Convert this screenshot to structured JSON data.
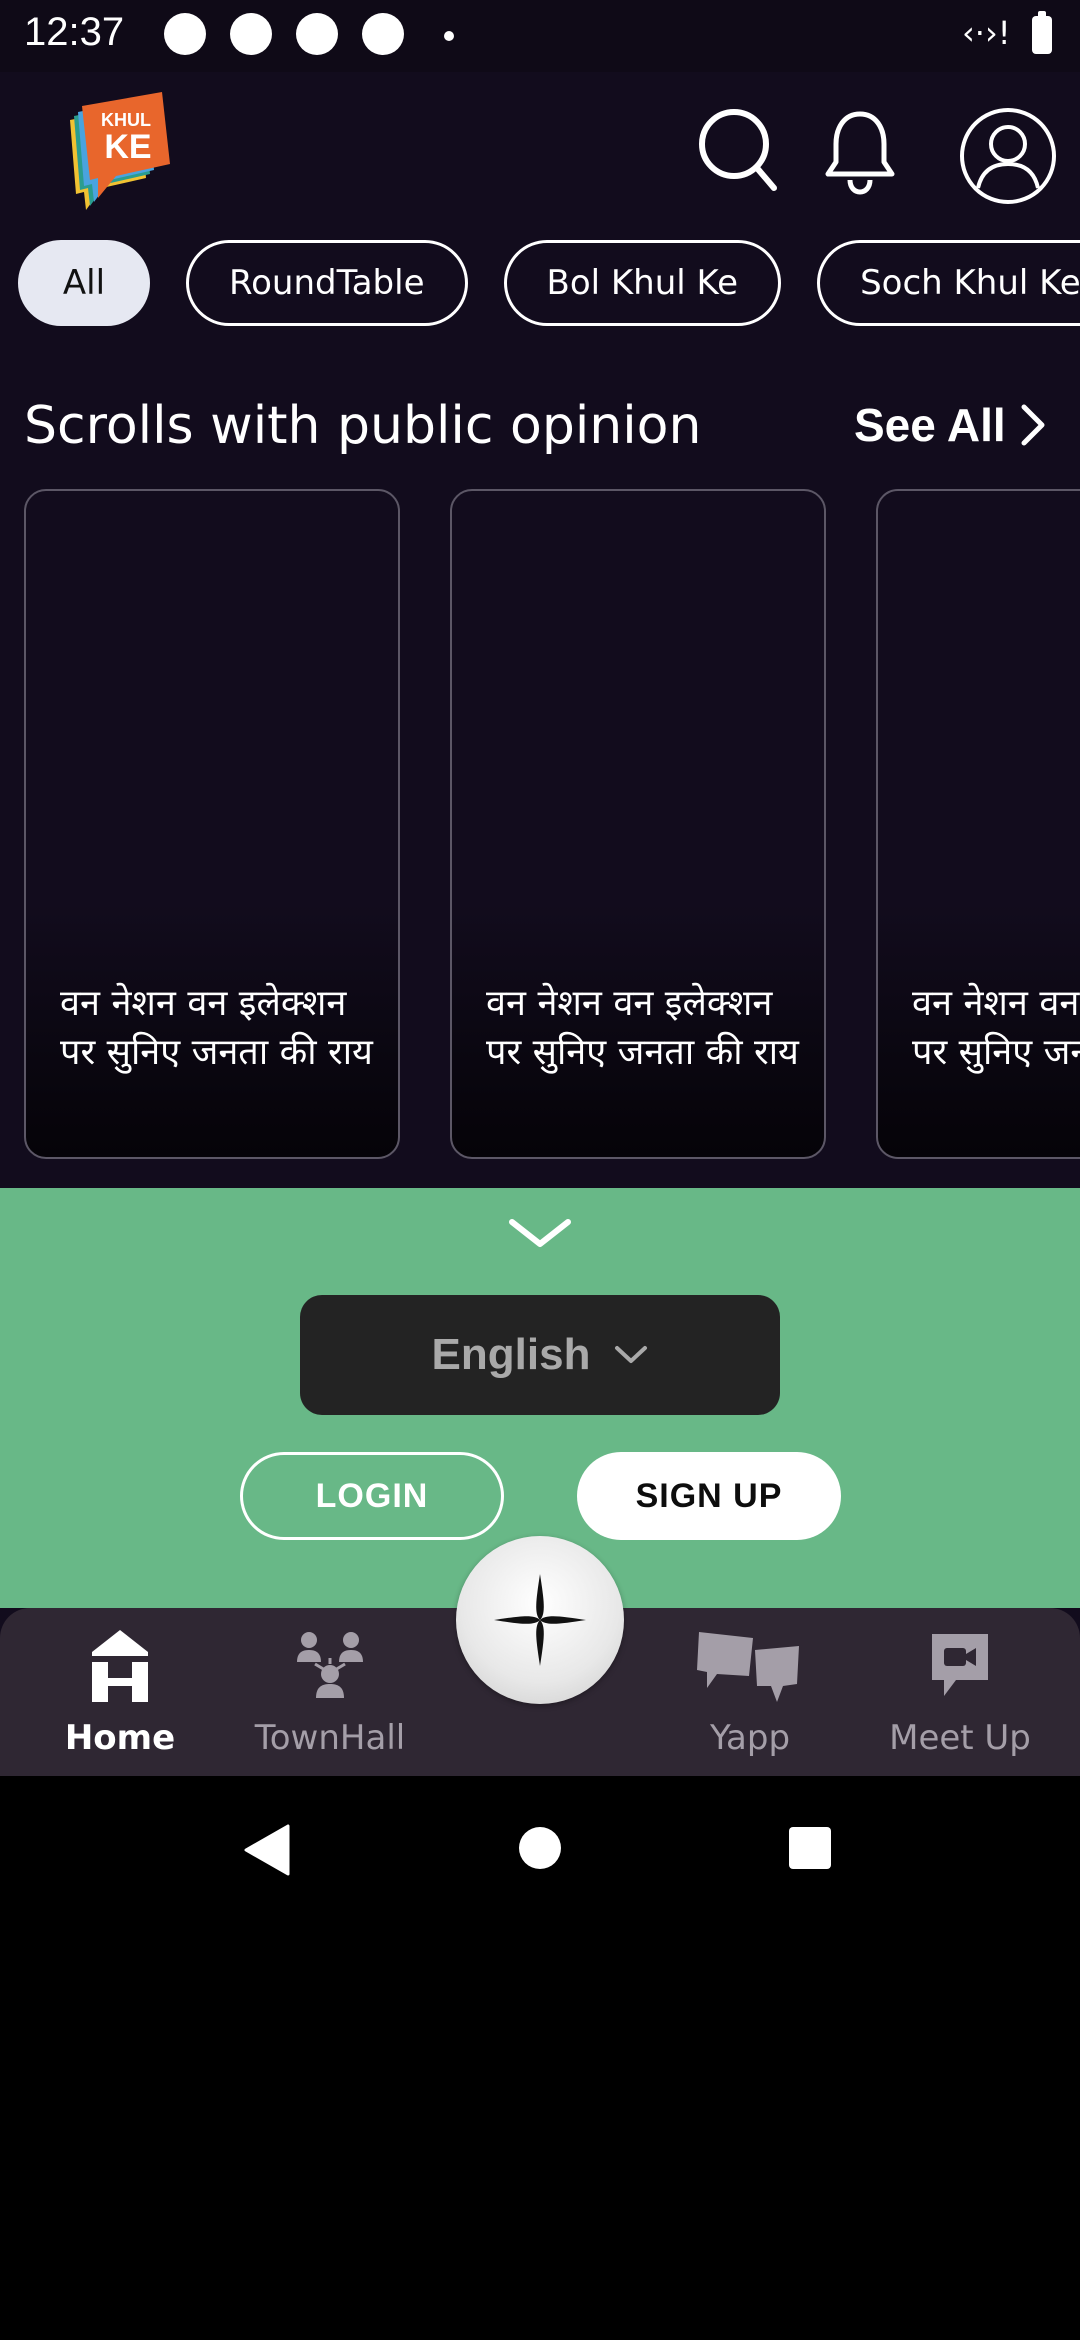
{
  "status_bar": {
    "time": "12:37",
    "network": "‹·›!"
  },
  "header": {
    "logo_top": "KHUL",
    "logo_bottom": "KE"
  },
  "chips": [
    "All",
    "RoundTable",
    "Bol Khul Ke",
    "Soch Khul Ke"
  ],
  "section": {
    "title": "Scrolls with public opinion",
    "see_all": "See All"
  },
  "cards": [
    {
      "text": "वन नेशन वन इलेक्शन पर सुनिए जनता की राय"
    },
    {
      "text": "वन नेशन वन इलेक्शन पर सुनिए जनता की राय"
    },
    {
      "text": "वन नेशन वन इलेक्शन पर सुनिए जनता की राय"
    }
  ],
  "auth_sheet": {
    "language": "English",
    "login": "LOGIN",
    "signup": "SIGN UP"
  },
  "bottom_nav": [
    {
      "label": "Home",
      "icon": "home-icon",
      "active": true
    },
    {
      "label": "TownHall",
      "icon": "townhall-icon",
      "active": false
    },
    {
      "label": "Yapp",
      "icon": "yapp-icon",
      "active": false
    },
    {
      "label": "Meet Up",
      "icon": "meetup-icon",
      "active": false
    }
  ],
  "colors": {
    "background": "#120c1d",
    "sheet": "#68b887",
    "nav": "#2f2733",
    "logo": "#e8662c"
  }
}
